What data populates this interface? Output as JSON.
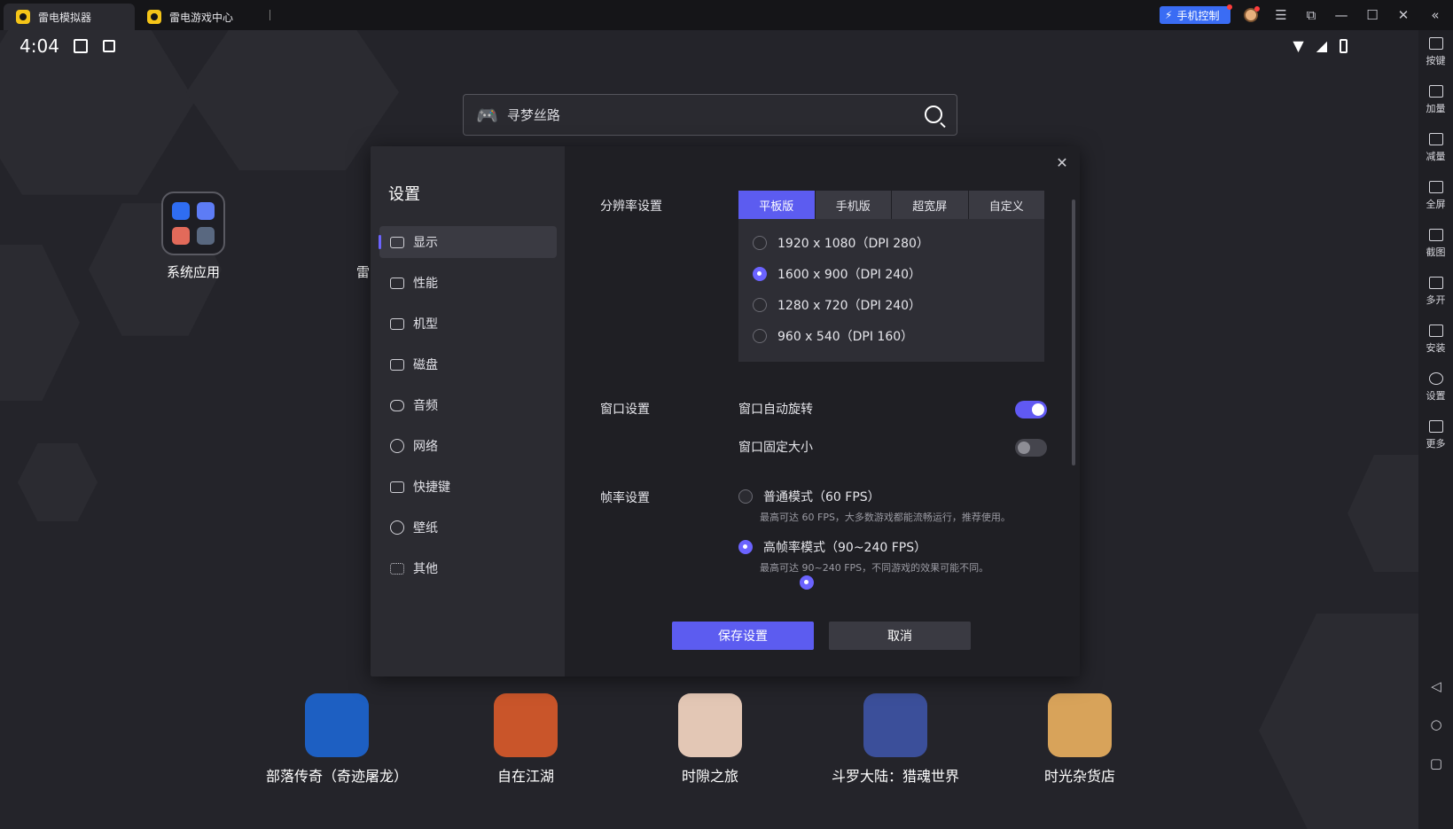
{
  "titlebar": {
    "tabs": [
      {
        "label": "雷电模拟器",
        "active": true
      },
      {
        "label": "雷电游戏中心",
        "active": false
      }
    ],
    "phone_control": "手机控制",
    "controls": {
      "menu": "☰",
      "minimize": "—",
      "restore": "☐",
      "close": "✕",
      "collapse": "«",
      "window": "⧉"
    }
  },
  "status": {
    "time": "4:04"
  },
  "search": {
    "text": "寻梦丝路"
  },
  "home": {
    "system_apps_label": "系统应用",
    "partial_label": "雷"
  },
  "dock": [
    {
      "label": "部落传奇（奇迹屠龙）",
      "color": "#1d5fc2"
    },
    {
      "label": "自在江湖",
      "color": "#c9552a"
    },
    {
      "label": "时隙之旅",
      "color": "#e3c7b5"
    },
    {
      "label": "斗罗大陆：猎魂世界",
      "color": "#3b4f9a"
    },
    {
      "label": "时光杂货店",
      "color": "#d8a35a"
    }
  ],
  "sidebar": {
    "items": [
      "按键",
      "加量",
      "减量",
      "全屏",
      "截图",
      "多开",
      "安装",
      "设置",
      "更多"
    ],
    "nav": {
      "back": "◁",
      "home": "○",
      "recent": "▢"
    }
  },
  "settings": {
    "title": "设置",
    "nav": [
      "显示",
      "性能",
      "机型",
      "磁盘",
      "音频",
      "网络",
      "快捷键",
      "壁纸",
      "其他"
    ],
    "active_nav": "显示",
    "close": "✕",
    "resolution": {
      "label": "分辨率设置",
      "tabs": [
        "平板版",
        "手机版",
        "超宽屏",
        "自定义"
      ],
      "active_tab": "平板版",
      "options": [
        "1920 x 1080（DPI 280）",
        "1600 x 900（DPI 240）",
        "1280 x 720（DPI 240）",
        "960 x 540（DPI 160）"
      ],
      "selected": "1600 x 900（DPI 240）"
    },
    "window": {
      "label": "窗口设置",
      "auto_rotate": {
        "label": "窗口自动旋转",
        "on": true
      },
      "fixed_size": {
        "label": "窗口固定大小",
        "on": false
      }
    },
    "fps": {
      "label": "帧率设置",
      "normal": {
        "label": "普通模式（60 FPS）",
        "desc": "最高可达 60 FPS，大多数游戏都能流畅运行，推荐使用。"
      },
      "high": {
        "label": "高帧率模式（90~240 FPS）",
        "desc": "最高可达 90~240 FPS，不同游戏的效果可能不同。"
      },
      "selected": "high"
    },
    "buttons": {
      "save": "保存设置",
      "cancel": "取消"
    }
  },
  "colors": {
    "accent": "#5c5cf0",
    "phone_control": "#3a6cf4",
    "tab_icon": "#f5c518"
  }
}
